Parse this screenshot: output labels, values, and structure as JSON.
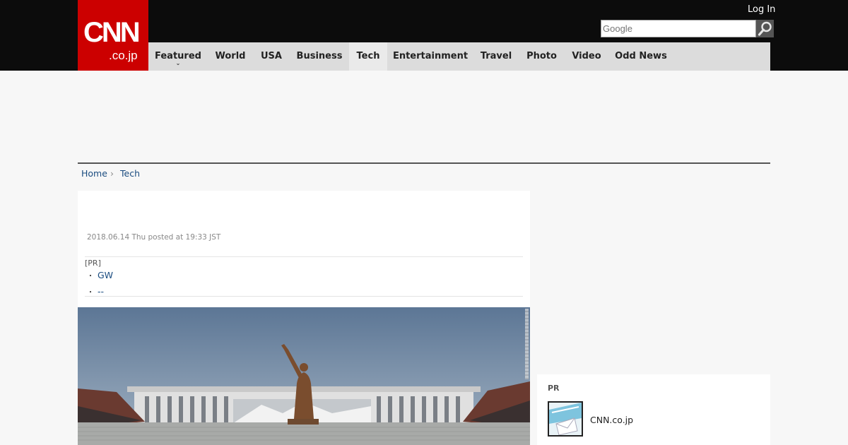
{
  "header": {
    "logo_main": "CNN",
    "logo_sub": ".co.jp",
    "login_label": "Log In",
    "search_placeholder": "Google"
  },
  "nav": {
    "items": [
      {
        "label": "Featured"
      },
      {
        "label": "World"
      },
      {
        "label": "USA"
      },
      {
        "label": "Business"
      },
      {
        "label": "Tech"
      },
      {
        "label": "Entertainment"
      },
      {
        "label": "Travel"
      },
      {
        "label": "Photo"
      },
      {
        "label": "Video"
      },
      {
        "label": "Odd News"
      }
    ],
    "active": "Tech"
  },
  "breadcrumb": {
    "home": "Home",
    "separator": "›",
    "current": "Tech"
  },
  "article": {
    "dateline": "2018.06.14 Thu posted at 19:33 JST",
    "pr_label": "[PR]",
    "pr_links": [
      {
        "bullet": "・",
        "text": "GW"
      },
      {
        "bullet": "・",
        "text": "--"
      }
    ]
  },
  "sidebar": {
    "pr_header": "PR",
    "pr_item_title": "CNN.co.jp"
  },
  "colors": {
    "brand_red": "#cc0000",
    "header_bg": "#0c0c0c",
    "nav_bg": "#dcdcdc",
    "link_blue": "#1a4c80"
  },
  "icons": {
    "search": "magnifier-icon",
    "nav_dropdown": "chevron-down-icon",
    "breadcrumb_sep": "chevron-right-icon"
  }
}
